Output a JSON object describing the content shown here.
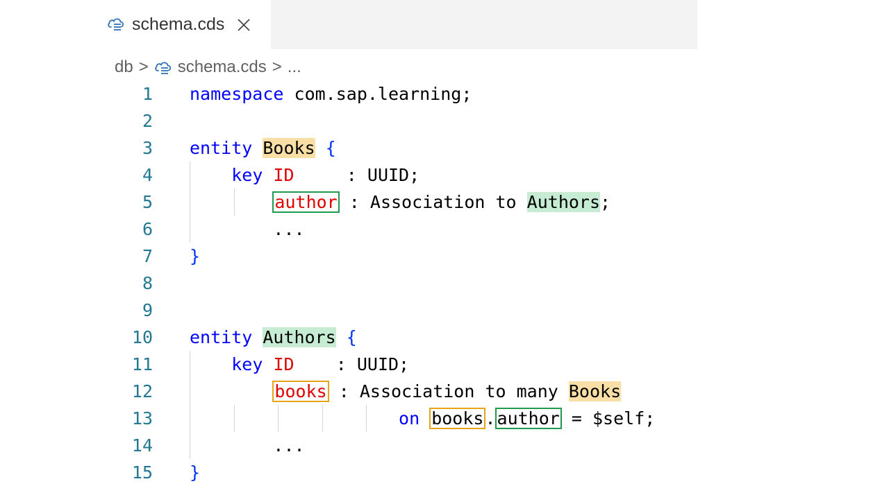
{
  "tab": {
    "label": "schema.cds"
  },
  "breadcrumb": {
    "folder": "db",
    "sep1": ">",
    "file": "schema.cds",
    "sep2": ">",
    "more": "..."
  },
  "lines": [
    {
      "num": "1",
      "parts": [
        {
          "t": "namespace",
          "c": "kw"
        },
        {
          "t": " com.sap.learning;",
          "c": ""
        }
      ]
    },
    {
      "num": "2",
      "parts": []
    },
    {
      "num": "3",
      "parts": [
        {
          "t": "entity",
          "c": "kw"
        },
        {
          "t": " ",
          "c": ""
        },
        {
          "t": "Books",
          "c": "hl-orange"
        },
        {
          "t": " ",
          "c": ""
        },
        {
          "t": "{",
          "c": "br"
        }
      ]
    },
    {
      "num": "4",
      "parts": [
        {
          "t": "    ",
          "c": ""
        },
        {
          "t": "key",
          "c": "kw"
        },
        {
          "t": " ",
          "c": ""
        },
        {
          "t": "ID",
          "c": "fld"
        },
        {
          "t": "     : UUID;",
          "c": ""
        }
      ]
    },
    {
      "num": "5",
      "parts": [
        {
          "t": "        ",
          "c": ""
        },
        {
          "t": "author",
          "c": "fld box-green"
        },
        {
          "t": " : Association to ",
          "c": ""
        },
        {
          "t": "Authors",
          "c": "hl-green"
        },
        {
          "t": ";",
          "c": ""
        }
      ]
    },
    {
      "num": "6",
      "parts": [
        {
          "t": "        ...",
          "c": ""
        }
      ]
    },
    {
      "num": "7",
      "parts": [
        {
          "t": "}",
          "c": "br"
        }
      ]
    },
    {
      "num": "8",
      "parts": []
    },
    {
      "num": "9",
      "parts": []
    },
    {
      "num": "10",
      "parts": [
        {
          "t": "entity",
          "c": "kw"
        },
        {
          "t": " ",
          "c": ""
        },
        {
          "t": "Authors",
          "c": "hl-green"
        },
        {
          "t": " ",
          "c": ""
        },
        {
          "t": "{",
          "c": "br"
        }
      ]
    },
    {
      "num": "11",
      "parts": [
        {
          "t": "    ",
          "c": ""
        },
        {
          "t": "key",
          "c": "kw"
        },
        {
          "t": " ",
          "c": ""
        },
        {
          "t": "ID",
          "c": "fld"
        },
        {
          "t": "    : UUID;",
          "c": ""
        }
      ]
    },
    {
      "num": "12",
      "parts": [
        {
          "t": "        ",
          "c": ""
        },
        {
          "t": "books",
          "c": "fld box-orange"
        },
        {
          "t": " : Association to many ",
          "c": ""
        },
        {
          "t": "Books",
          "c": "hl-orange"
        }
      ]
    },
    {
      "num": "13",
      "parts": [
        {
          "t": "                    ",
          "c": ""
        },
        {
          "t": "on",
          "c": "kw"
        },
        {
          "t": " ",
          "c": ""
        },
        {
          "t": "books",
          "c": "box-orange"
        },
        {
          "t": ".",
          "c": ""
        },
        {
          "t": "author",
          "c": "box-green"
        },
        {
          "t": " = $self;",
          "c": ""
        }
      ]
    },
    {
      "num": "14",
      "parts": [
        {
          "t": "        ...",
          "c": ""
        }
      ]
    },
    {
      "num": "15",
      "parts": [
        {
          "t": "}",
          "c": "br"
        }
      ]
    }
  ],
  "colors": {
    "keyword": "#0000ff",
    "field": "#e00000",
    "line_number": "#237893",
    "highlight_orange": "#f9dfa5",
    "highlight_green": "#c6ecd4",
    "box_orange": "#e8a317",
    "box_green": "#1e9b4c"
  }
}
